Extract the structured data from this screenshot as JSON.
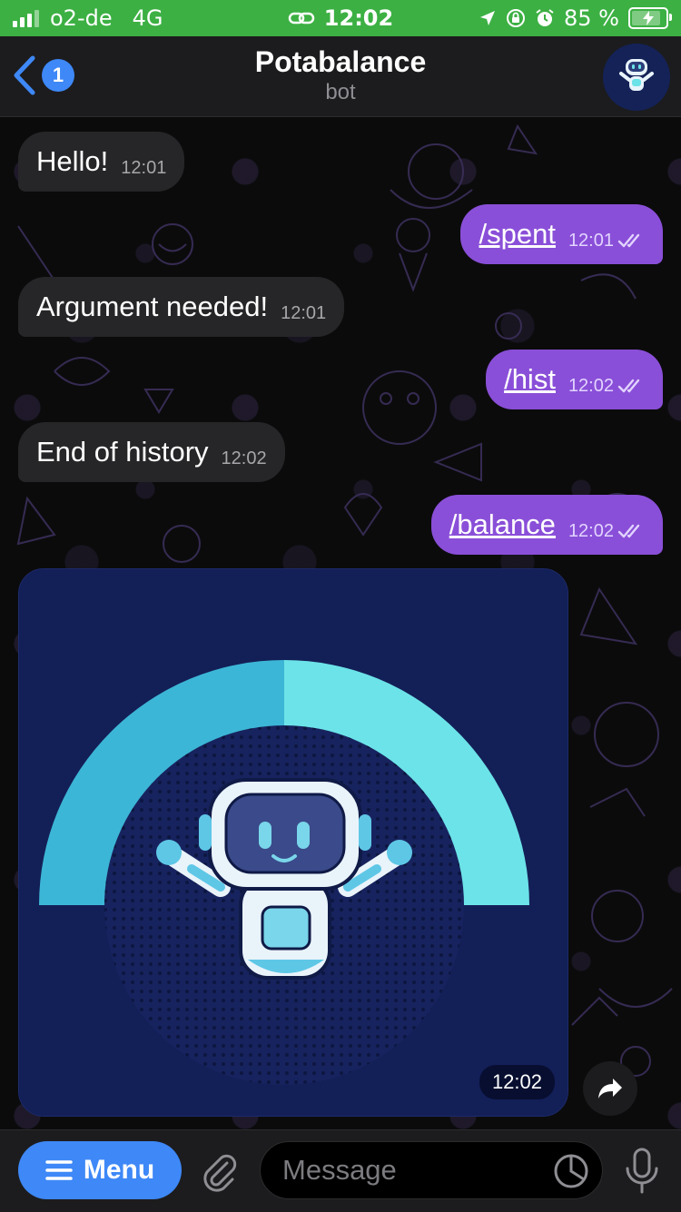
{
  "status_bar": {
    "carrier": "o2-de",
    "network": "4G",
    "time": "12:02",
    "battery_percent": "85 %",
    "link_icon": "link-icon",
    "location_icon": "location-arrow-icon",
    "lock_icon": "orientation-lock-icon",
    "alarm_icon": "alarm-icon",
    "battery_icon": "battery-charging-icon",
    "signal_bars": 4,
    "signal_bars_active": 3,
    "battery_level": 0.85,
    "bar_color": "#3cb043"
  },
  "header": {
    "back_badge": "1",
    "title": "Potabalance",
    "subtitle": "bot"
  },
  "messages": [
    {
      "direction": "in",
      "text": "Hello!",
      "time": "12:01"
    },
    {
      "direction": "out",
      "text": "/spent",
      "time": "12:01",
      "read": true
    },
    {
      "direction": "in",
      "text": "Argument needed!",
      "time": "12:01"
    },
    {
      "direction": "out",
      "text": "/hist",
      "time": "12:02",
      "read": true
    },
    {
      "direction": "in",
      "text": "End of history",
      "time": "12:02"
    },
    {
      "direction": "out",
      "text": "/balance",
      "time": "12:02",
      "read": true
    }
  ],
  "photo_message": {
    "time": "12:02",
    "gauge_fraction": 0.5,
    "gauge_colors": {
      "filled_left": "#3cb6d6",
      "filled_right": "#6ce3e8",
      "background": "#131f57"
    }
  },
  "input_bar": {
    "menu_label": "Menu",
    "placeholder": "Message"
  },
  "colors": {
    "accent_blue": "#3e88f7",
    "outgoing_bubble": "#8a4fd8",
    "incoming_bubble": "#262628"
  }
}
